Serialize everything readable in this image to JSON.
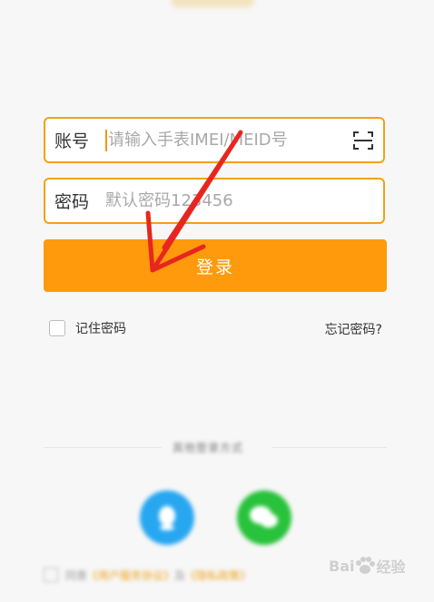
{
  "login_form": {
    "account": {
      "label": "账号",
      "placeholder": "请输入手表IMEI/MEID号",
      "value": ""
    },
    "password": {
      "label": "密码",
      "placeholder": "默认密码123456",
      "value": ""
    },
    "login_button": "登录",
    "remember_label": "记住密码",
    "remember_checked": false,
    "forgot_link": "忘记密码?"
  },
  "other_login": {
    "label": "其他登录方式",
    "options": [
      "qq-icon",
      "wechat-icon"
    ]
  },
  "agreement": {
    "prefix": "同意",
    "user_agreement": "《用户服务协议》",
    "and": "及",
    "privacy_policy": "《隐私政策》"
  },
  "watermark": {
    "brand": "Bai",
    "suffix": "经验",
    "icon": "paw-icon"
  },
  "colors": {
    "accent": "#ff9a0c",
    "border": "#f0a21a",
    "annotation_arrow": "#e8261f"
  }
}
